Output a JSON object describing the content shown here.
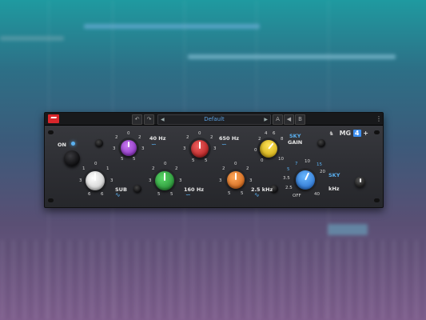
{
  "preset": {
    "name": "Default"
  },
  "power": {
    "label": "ON"
  },
  "brand": {
    "model": "MG",
    "version": "4",
    "suffix": "+"
  },
  "bands": {
    "sub": {
      "label": "SUB"
    },
    "b40": {
      "label": "40 Hz"
    },
    "b160": {
      "label": "160 Hz"
    },
    "b650": {
      "label": "650 Hz"
    },
    "b2k5": {
      "label": "2.5 kHz"
    },
    "sky_gain": {
      "label1": "SKY",
      "label2": "GAIN"
    },
    "sky_freq": {
      "label1": "SKY",
      "label2": "kHz"
    }
  },
  "scales": {
    "standard": [
      "0",
      "1",
      "2",
      "3",
      "4",
      "5",
      "5",
      "3",
      "2",
      "1"
    ],
    "sky_gain": [
      "4",
      "6",
      "8",
      "2",
      "10",
      "0",
      "0"
    ],
    "sky_freq": [
      "7",
      "10",
      "5",
      "15",
      "3.5",
      "20",
      "2.5",
      "40",
      "OFF"
    ]
  },
  "colors": {
    "white": "#e6e6e6",
    "purple": "#9a3ad6",
    "green": "#2aa838",
    "red": "#d82424",
    "orange": "#f07a1a",
    "yellow": "#f0c810",
    "blue": "#2f8ff0"
  }
}
